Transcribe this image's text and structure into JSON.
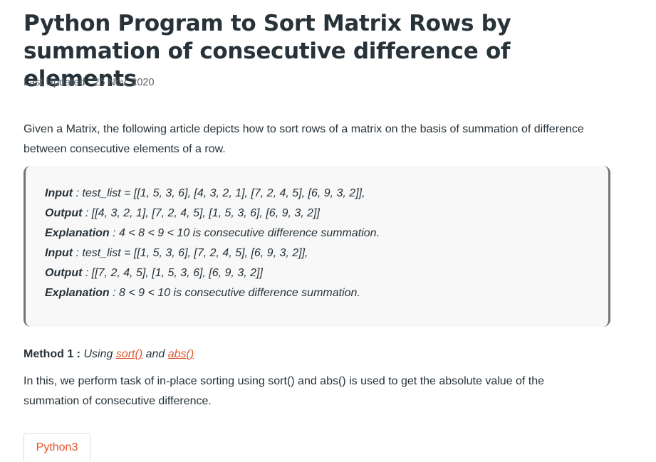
{
  "article": {
    "title": "Python Program to Sort Matrix Rows by summation of consecutive difference of elements",
    "last_updated": "Last Updated : 26 Nov, 2020",
    "intro": "Given a Matrix, the following article depicts how to sort rows of a matrix on the basis of summation of difference between consecutive elements of a row."
  },
  "example": {
    "lines": [
      {
        "label": "Input",
        "text": " : test_list = [[1, 5, 3, 6], [4, 3, 2, 1], [7, 2, 4, 5], [6, 9, 3, 2]],"
      },
      {
        "label": "Output",
        "text": " : [[4, 3, 2, 1], [7, 2, 4, 5], [1, 5, 3, 6], [6, 9, 3, 2]]"
      },
      {
        "label": "Explanation",
        "text": " : 4 < 8 < 9 < 10 is consecutive difference summation."
      },
      {
        "label": "Input",
        "text": " : test_list = [[1, 5, 3, 6], [7, 2, 4, 5], [6, 9, 3, 2]],"
      },
      {
        "label": "Output",
        "text": " : [[7, 2, 4, 5], [1, 5, 3, 6], [6, 9, 3, 2]]"
      },
      {
        "label": "Explanation",
        "text": " : 8 < 9 < 10 is consecutive difference summation."
      }
    ]
  },
  "method": {
    "label": "Method 1 :",
    "using": "Using",
    "link1": "sort()",
    "and": "and",
    "link2": "abs()",
    "description": "In this, we perform task of in-place sorting using sort() and abs() is used to get the absolute value of the summation of consecutive difference."
  },
  "code_tab": {
    "label": "Python3"
  },
  "colors": {
    "text": "#273239",
    "link": "#e0552b",
    "example_bg": "#f8f8f8",
    "example_border": "#6f7579"
  }
}
